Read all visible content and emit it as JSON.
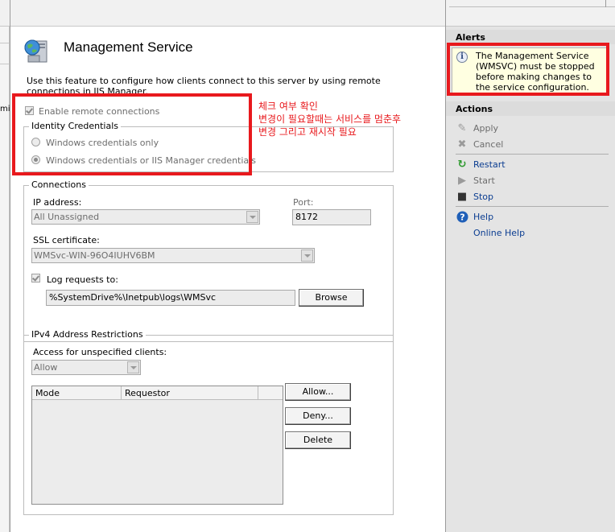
{
  "page": {
    "title": "Management Service",
    "description": "Use this feature to configure how clients connect to this server by using remote connections in IIS Manager.",
    "left_stub_text": "mi"
  },
  "remote": {
    "enable_label": "Enable remote connections",
    "enable_checked": true
  },
  "identity": {
    "legend": "Identity Credentials",
    "options": [
      "Windows credentials only",
      "Windows credentials or IIS Manager credentials"
    ],
    "selected_index": 1
  },
  "connections": {
    "legend": "Connections",
    "ip_label": "IP address:",
    "ip_value": "All Unassigned",
    "port_label": "Port:",
    "port_value": "8172",
    "ssl_label": "SSL certificate:",
    "ssl_value": "WMSvc-WIN-96O4IUHV6BM",
    "log_label": "Log requests to:",
    "log_checked": true,
    "log_path": "%SystemDrive%\\Inetpub\\logs\\WMSvc",
    "browse_label": "Browse"
  },
  "ipv4": {
    "legend": "IPv4 Address Restrictions",
    "access_label": "Access for unspecified clients:",
    "access_value": "Allow",
    "columns": [
      "Mode",
      "Requestor"
    ],
    "buttons": [
      "Allow...",
      "Deny...",
      "Delete"
    ]
  },
  "annotation": {
    "lines": [
      "체크 여부 확인",
      "변경이 필요할때는 서비스를 멈춘후",
      "변경 그리고 재시작 필요"
    ],
    "color": "#e8191d"
  },
  "alerts": {
    "title": "Alerts",
    "message": "The Management Service (WMSVC) must be stopped before making changes to the service configuration."
  },
  "actions": {
    "title": "Actions",
    "items": [
      {
        "label": "Apply",
        "icon": "apply-icon",
        "enabled": false
      },
      {
        "label": "Cancel",
        "icon": "cancel-icon",
        "enabled": false
      },
      {
        "label": "Restart",
        "icon": "restart-icon",
        "enabled": true
      },
      {
        "label": "Start",
        "icon": "start-icon",
        "enabled": false
      },
      {
        "label": "Stop",
        "icon": "stop-icon",
        "enabled": true
      },
      {
        "label": "Help",
        "icon": "help-icon",
        "enabled": true
      },
      {
        "label": "Online Help",
        "icon": "",
        "enabled": true
      }
    ]
  },
  "colors": {
    "accent_link": "#0b3d91",
    "highlight_red": "#e8191d",
    "alert_bg": "#ffffe1"
  }
}
